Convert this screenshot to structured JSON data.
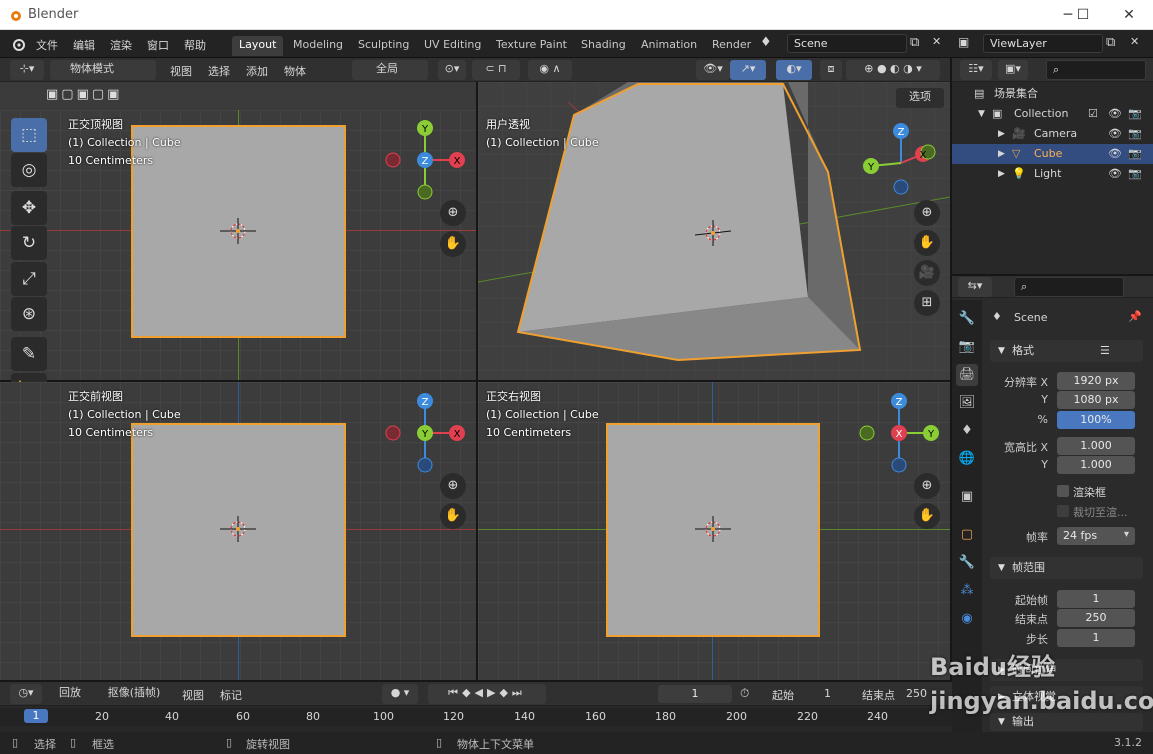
{
  "window": {
    "title": "Blender",
    "min": "─",
    "max": "☐",
    "close": "✕"
  },
  "menu": [
    "文件",
    "编辑",
    "渲染",
    "窗口",
    "帮助"
  ],
  "workspaces": [
    "Layout",
    "Modeling",
    "Sculpting",
    "UV Editing",
    "Texture Paint",
    "Shading",
    "Animation",
    "Render"
  ],
  "scene": {
    "name": "Scene"
  },
  "viewlayer": {
    "name": "ViewLayer"
  },
  "viewport_header": {
    "mode": "物体模式",
    "items": [
      "视图",
      "选择",
      "添加",
      "物体"
    ],
    "transform": "全局",
    "options": "选项"
  },
  "views": [
    {
      "title": "正交顶视图",
      "collection": "(1) Collection | Cube",
      "units": "10 Centimeters"
    },
    {
      "title": "用户透视",
      "collection": "(1) Collection | Cube",
      "units": ""
    },
    {
      "title": "正交前视图",
      "collection": "(1) Collection | Cube",
      "units": "10 Centimeters"
    },
    {
      "title": "正交右视图",
      "collection": "(1) Collection | Cube",
      "units": "10 Centimeters"
    }
  ],
  "gizmo": {
    "x": "X",
    "y": "Y",
    "z": "Z",
    "xcolor": "#e0404f",
    "ycolor": "#8acd34",
    "zcolor": "#3d8bdc"
  },
  "outliner": {
    "root": "场景集合",
    "collection": "Collection",
    "items": [
      "Camera",
      "Cube",
      "Light"
    ],
    "selected": "Cube"
  },
  "properties": {
    "scene": "Scene",
    "format_section": "格式",
    "res_x_label": "分辨率 X",
    "res_x": "1920 px",
    "res_y_label": "Y",
    "res_y": "1080 px",
    "percent_label": "%",
    "percent": "100%",
    "aspect_x_label": "宽高比 X",
    "aspect_x": "1.000",
    "aspect_y_label": "Y",
    "aspect_y": "1.000",
    "border": "渲染框",
    "crop": "裁切至渲...",
    "fps_label": "帧率",
    "fps": "24 fps",
    "frame_range_section": "帧范围",
    "start_label": "起始帧",
    "start": "1",
    "end_label": "结束点",
    "end": "250",
    "step_label": "步长",
    "step": "1",
    "stereo_section": "立体视觉",
    "output_section": "输出",
    "time_section": "时间拉伸"
  },
  "timeline": {
    "playback": "回放",
    "keying": "抠像(插帧)",
    "view": "视图",
    "marker": "标记",
    "current_frame": "1",
    "start_label": "起始",
    "start": "1",
    "end_label": "结束点",
    "end": "250",
    "ticks": [
      "1",
      "20",
      "40",
      "60",
      "80",
      "100",
      "120",
      "140",
      "160",
      "180",
      "200",
      "220",
      "240"
    ]
  },
  "status": {
    "select": "选择",
    "box": "框选",
    "rotate": "旋转视图",
    "context": "物体上下文菜单",
    "version": "3.1.2"
  },
  "watermark": "Baidu经验 jingyan.baidu.com"
}
